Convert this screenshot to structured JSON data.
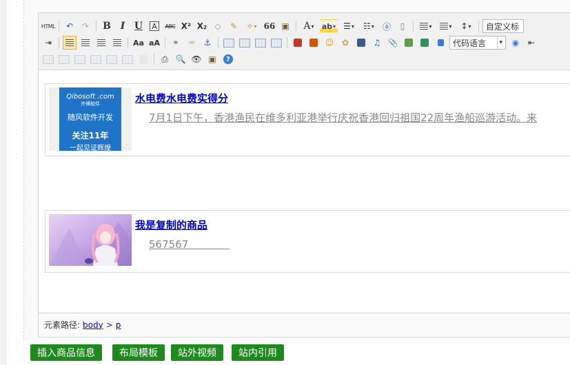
{
  "toolbar": {
    "html_label": "HTML",
    "bold": "B",
    "italic": "I",
    "underline": "U",
    "border": "A",
    "strike": "ABC",
    "superscript": "X²",
    "subscript": "X₂",
    "quote": "66",
    "forecolor": "A",
    "backcolor": "ab",
    "custom_style_select": "自定义标",
    "code_lang_select": "代码语言"
  },
  "content": {
    "items": [
      {
        "logo_brand": "Qibosoft .com",
        "logo_sub": "齐博软件",
        "logo_slogan": "随风软件开发",
        "logo_line1": "关注11年",
        "logo_line2": "一起见证辉煌",
        "title": "水电费水电费实得分",
        "desc": "7月1日下午，香港渔民在维多利亚港举行庆祝香港回归祖国22周年渔船巡游活动。来"
      },
      {
        "title": "我是复制的商品",
        "desc": "567567　　　　"
      }
    ]
  },
  "statusbar": {
    "label": "元素路径:",
    "crumb1": "body",
    "sep": ">",
    "crumb2": "p"
  },
  "buttons": {
    "insert_product": "插入商品信息",
    "layout_template": "布局模板",
    "external_video": "站外视频",
    "internal_quote": "站内引用"
  }
}
